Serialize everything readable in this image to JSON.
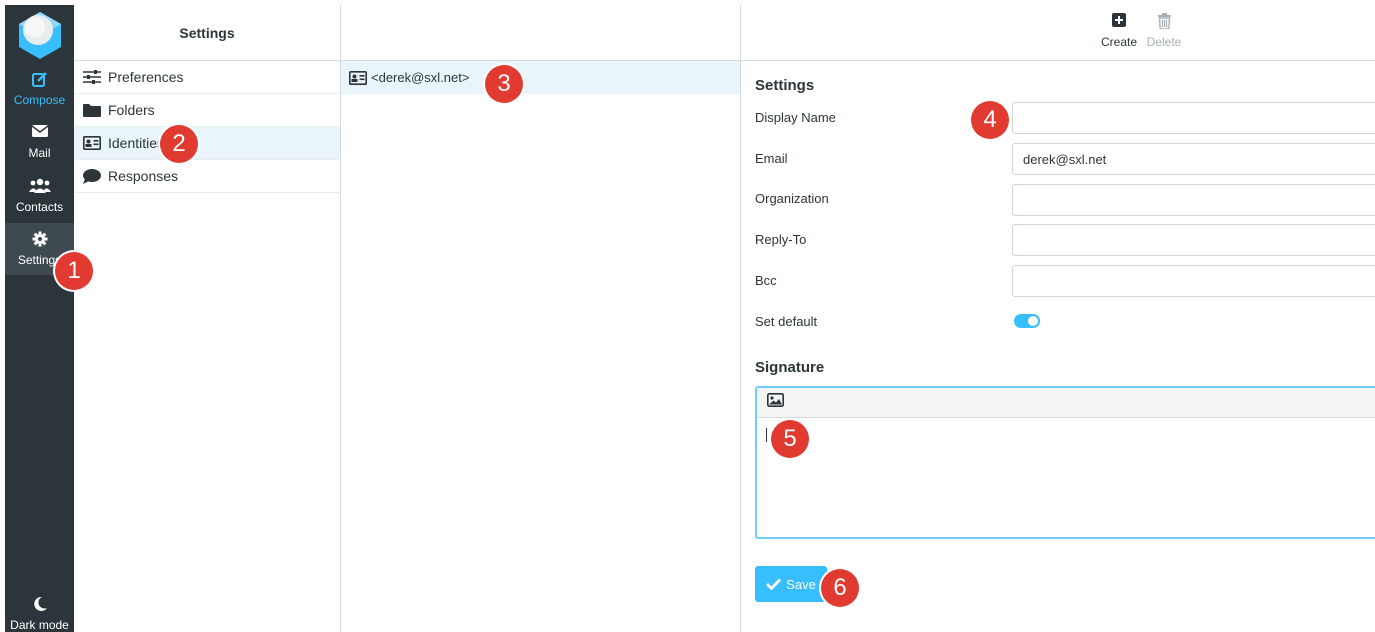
{
  "nav": {
    "items": [
      {
        "label": "Compose",
        "icon": "compose-icon"
      },
      {
        "label": "Mail",
        "icon": "envelope-icon"
      },
      {
        "label": "Contacts",
        "icon": "users-icon"
      },
      {
        "label": "Settings",
        "icon": "gear-icon"
      }
    ],
    "dark_mode_label": "Dark mode"
  },
  "settings_list": {
    "title": "Settings",
    "items": [
      {
        "label": "Preferences",
        "icon": "sliders-icon"
      },
      {
        "label": "Folders",
        "icon": "folder-icon"
      },
      {
        "label": "Identities",
        "icon": "id-card-icon"
      },
      {
        "label": "Responses",
        "icon": "comment-icon"
      }
    ],
    "selected": "Identities"
  },
  "identities": {
    "items": [
      {
        "label": "<derek@sxl.net>"
      }
    ]
  },
  "toolbar": {
    "create_label": "Create",
    "delete_label": "Delete"
  },
  "form": {
    "section_title": "Settings",
    "fields": [
      {
        "label": "Display Name",
        "value": ""
      },
      {
        "label": "Email",
        "value": "derek@sxl.net"
      },
      {
        "label": "Organization",
        "value": ""
      },
      {
        "label": "Reply-To",
        "value": ""
      },
      {
        "label": "Bcc",
        "value": ""
      }
    ],
    "set_default_label": "Set default",
    "set_default_on": true,
    "signature_title": "Signature",
    "signature_value": "",
    "save_label": "Save"
  },
  "markers": [
    "1",
    "2",
    "3",
    "4",
    "5",
    "6"
  ],
  "colors": {
    "accent": "#37beff",
    "nav_bg": "#2c363a",
    "marker": "#e03a31"
  }
}
